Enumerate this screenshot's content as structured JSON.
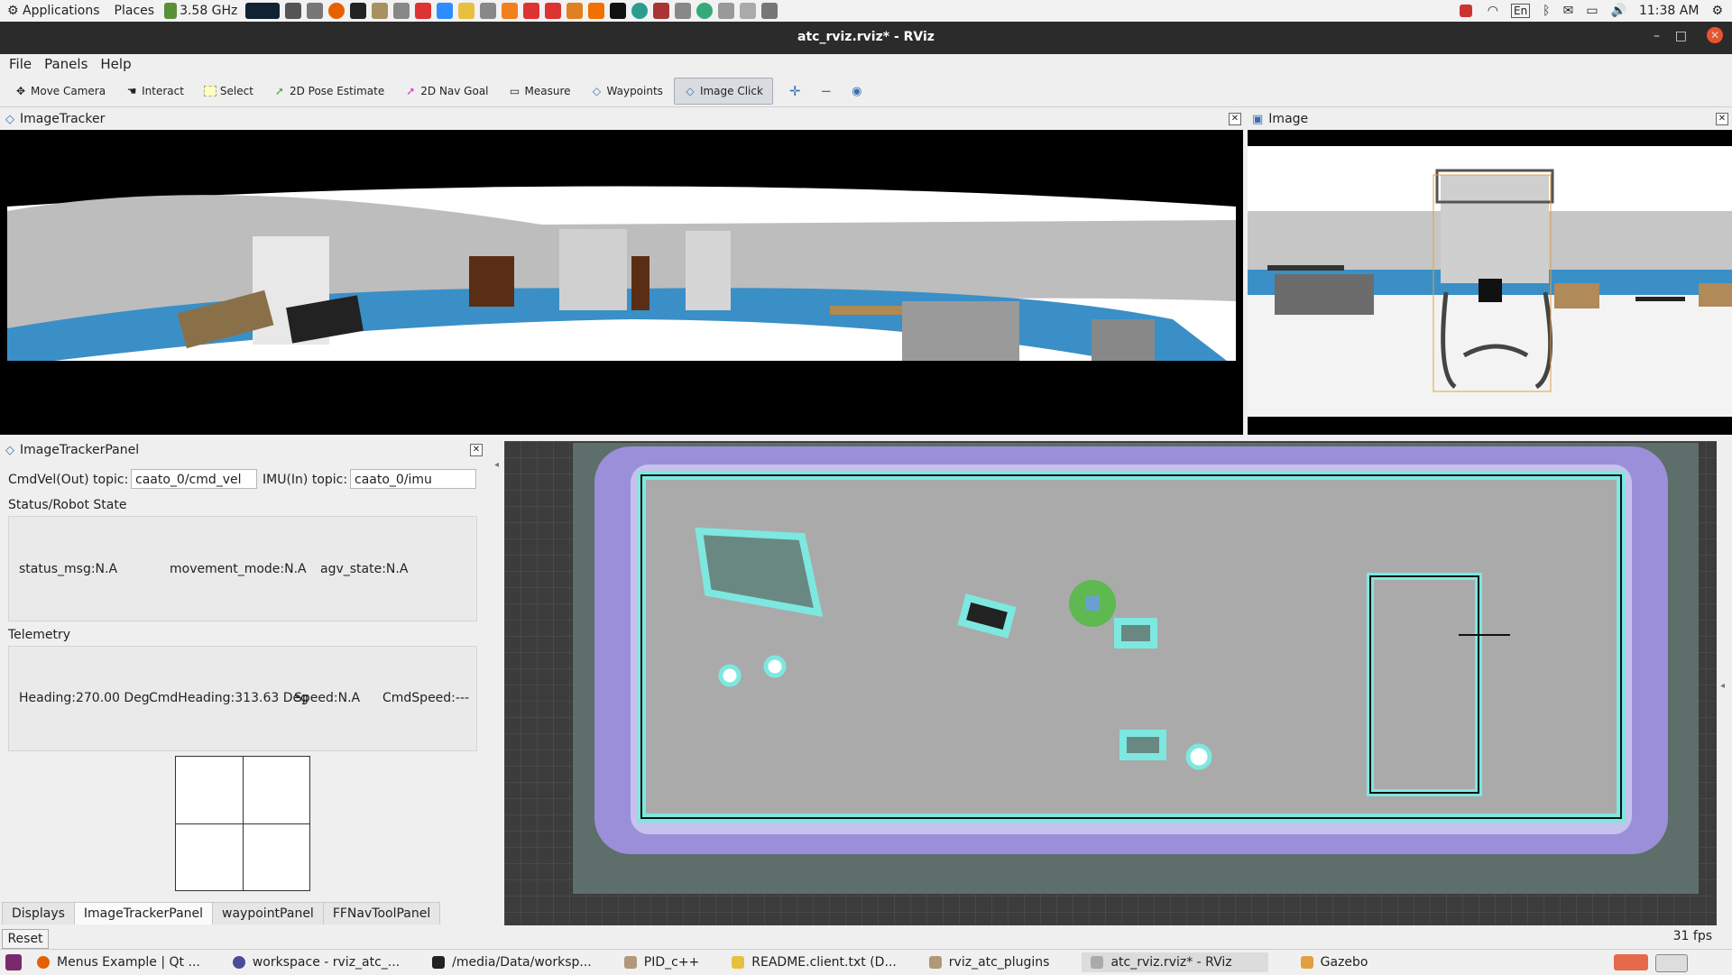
{
  "system_bar": {
    "applications": "Applications",
    "places": "Places",
    "cpu_freq": "3.58 GHz",
    "lang": "En",
    "clock": "11:38 AM"
  },
  "window": {
    "title": "atc_rviz.rviz* - RViz"
  },
  "menu": [
    "File",
    "Panels",
    "Help"
  ],
  "toolbar": {
    "move_camera": "Move Camera",
    "interact": "Interact",
    "select": "Select",
    "pose_estimate": "2D Pose Estimate",
    "nav_goal": "2D Nav Goal",
    "measure": "Measure",
    "waypoints": "Waypoints",
    "image_click": "Image Click"
  },
  "image_tracker": {
    "title": "ImageTracker"
  },
  "image_panel": {
    "title": "Image"
  },
  "tracker_panel": {
    "title": "ImageTrackerPanel",
    "cmdvel_label": "CmdVel(Out) topic:",
    "cmdvel_value": "caato_0/cmd_vel",
    "imu_label": "IMU(In) topic:",
    "imu_value": "caato_0/imu",
    "status_title": "Status/Robot State",
    "status_msg": "status_msg:N.A",
    "movement_mode": "movement_mode:N.A",
    "agv_state": "agv_state:N.A",
    "telemetry_title": "Telemetry",
    "heading": "Heading:270.00 Deg",
    "cmd_heading": "CmdHeading:313.63 Deg",
    "speed": "Speed:N.A",
    "cmd_speed": "CmdSpeed:---"
  },
  "bottom_tabs": [
    "Displays",
    "ImageTrackerPanel",
    "waypointPanel",
    "FFNavToolPanel"
  ],
  "reset_label": "Reset",
  "fps": "31 fps",
  "taskbar": [
    "Menus Example | Qt ...",
    "workspace - rviz_atc_...",
    "/media/Data/worksp...",
    "PID_c++",
    "README.client.txt (D...",
    "rviz_atc_plugins",
    "atc_rviz.rviz* - RViz",
    "Gazebo"
  ]
}
